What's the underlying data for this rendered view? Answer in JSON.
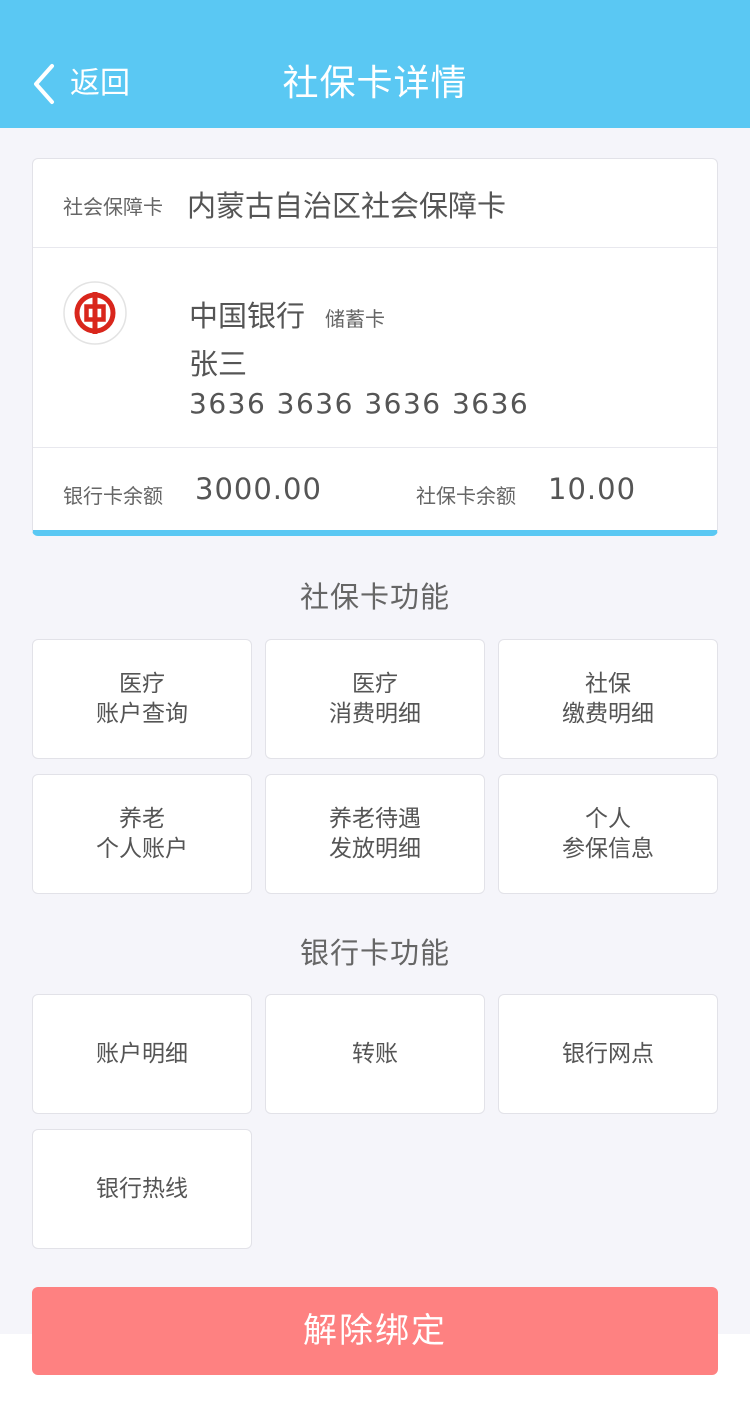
{
  "header": {
    "back_label": "返回",
    "title": "社保卡详情"
  },
  "card": {
    "ss_label": "社会保障卡",
    "ss_name": "内蒙古自治区社会保障卡",
    "bank_name": "中国银行",
    "card_type": "储蓄卡",
    "holder": "张三",
    "card_number": "3636 3636 3636 3636",
    "bank_balance_label": "银行卡余额",
    "bank_balance": "3000.00",
    "ss_balance_label": "社保卡余额",
    "ss_balance": "10.00"
  },
  "ss_section": {
    "title": "社保卡功能",
    "tiles": [
      {
        "line1": "医疗",
        "line2": "账户查询"
      },
      {
        "line1": "医疗",
        "line2": "消费明细"
      },
      {
        "line1": "社保",
        "line2": "缴费明细"
      },
      {
        "line1": "养老",
        "line2": "个人账户"
      },
      {
        "line1": "养老待遇",
        "line2": "发放明细"
      },
      {
        "line1": "个人",
        "line2": "参保信息"
      }
    ]
  },
  "bank_section": {
    "title": "银行卡功能",
    "tiles": [
      {
        "label": "账户明细"
      },
      {
        "label": "转账"
      },
      {
        "label": "银行网点"
      },
      {
        "label": "银行热线"
      }
    ]
  },
  "unbind_label": "解除绑定",
  "colors": {
    "header": "#5ac8f3",
    "background": "#f5f5fa",
    "unbind": "#fe8181",
    "bank_logo": "#d9261c"
  },
  "icons": {
    "back": "chevron-left-icon",
    "bank_logo": "boc-logo-icon"
  }
}
